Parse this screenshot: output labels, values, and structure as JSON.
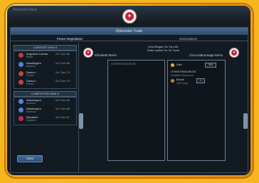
{
  "window": {
    "title_left": "Ambulant Biwis",
    "title_center": "Diplomatic Trade",
    "tabs": [
      "Peace Negotiation",
      "Declarations"
    ]
  },
  "sections": {
    "current_deals": "CURRENT DEALS",
    "completed_deals": "COMPLETED DEALS"
  },
  "current_deals": [
    {
      "leader": "Augustus Caesar",
      "civ": "Rome",
      "turn": "On Turn 60",
      "color": "#c03646"
    },
    {
      "leader": "Washington",
      "civ": "America",
      "turn": "On Turn 60",
      "color": "#5a7fd6"
    },
    {
      "leader": "Darius I",
      "civ": "Persia",
      "turn": "On Turn 70",
      "color": "#c1453c"
    },
    {
      "leader": "Darius I",
      "civ": "Persia",
      "turn": "On Turn 70",
      "color": "#c1453c"
    }
  ],
  "completed_deals": [
    {
      "leader": "Washington",
      "civ": "America",
      "turn": "On Turn 64",
      "color": "#5a7fd6"
    },
    {
      "leader": "Washington",
      "civ": "America",
      "turn": "On Turn 60",
      "color": "#5a7fd6"
    },
    {
      "leader": "Elizabeth",
      "civ": "England",
      "turn": "On Turn 67",
      "color": "#c02d48"
    }
  ],
  "buttons": {
    "clear": "Clear"
  },
  "trade": {
    "line1": "Deal Began On Turn 60",
    "line2": "Deal Lasted For 30 Turns",
    "left_label": "Elizabeth Items",
    "right_label": "Civo Kattrunnage Items",
    "left_box_header": "OTHER RESOURCES",
    "right_gold_label": "Gold",
    "right_gold_amount": "300",
    "right_resources_header": "OTHER RESOURCES",
    "right_resources_sub": "Available Resources",
    "right_item_label": "Bronze",
    "right_item_sub": "100 Turns",
    "right_item_amount": "1"
  },
  "colors": {
    "accent": "#c9223f",
    "panel": "#121a22",
    "frame": "#f5a412"
  }
}
